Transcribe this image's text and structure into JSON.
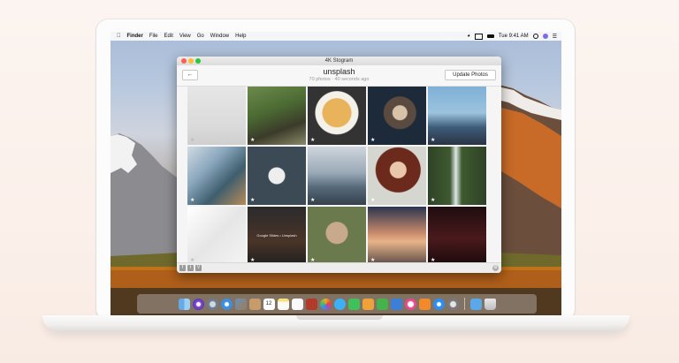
{
  "menubar": {
    "apple_icon": "apple-icon",
    "app_name": "Finder",
    "menus": [
      "File",
      "Edit",
      "View",
      "Go",
      "Window",
      "Help"
    ],
    "status_icons": [
      "wifi-icon",
      "airplay-icon",
      "battery-icon"
    ],
    "clock": "Tue 9:41 AM",
    "right_icons": [
      "search-icon",
      "siri-icon",
      "notifications-icon"
    ]
  },
  "window": {
    "title": "4K Stogram",
    "back_label": "←",
    "source_title": "unsplash",
    "subtitle": "70 photos · 40 seconds ago",
    "update_button": "Update Photos",
    "caption": "Google Slides • Unsplash",
    "star_glyph": "★",
    "social": [
      "f",
      "t",
      "V"
    ]
  },
  "dock": {
    "apps": [
      "finder",
      "siri",
      "launchpad",
      "safari",
      "photos-preview",
      "contacts",
      "calendar",
      "notes",
      "reminders",
      "photo-booth",
      "photos",
      "messages",
      "facetime",
      "pages",
      "numbers",
      "keynote",
      "itunes",
      "ibooks",
      "app-store",
      "system-preferences",
      "downloads",
      "trash"
    ],
    "calendar_day": "12"
  },
  "colors": {
    "accent": "#4a90e2",
    "close": "#fe5f57",
    "minimize": "#febc2e",
    "zoom": "#28c840"
  }
}
